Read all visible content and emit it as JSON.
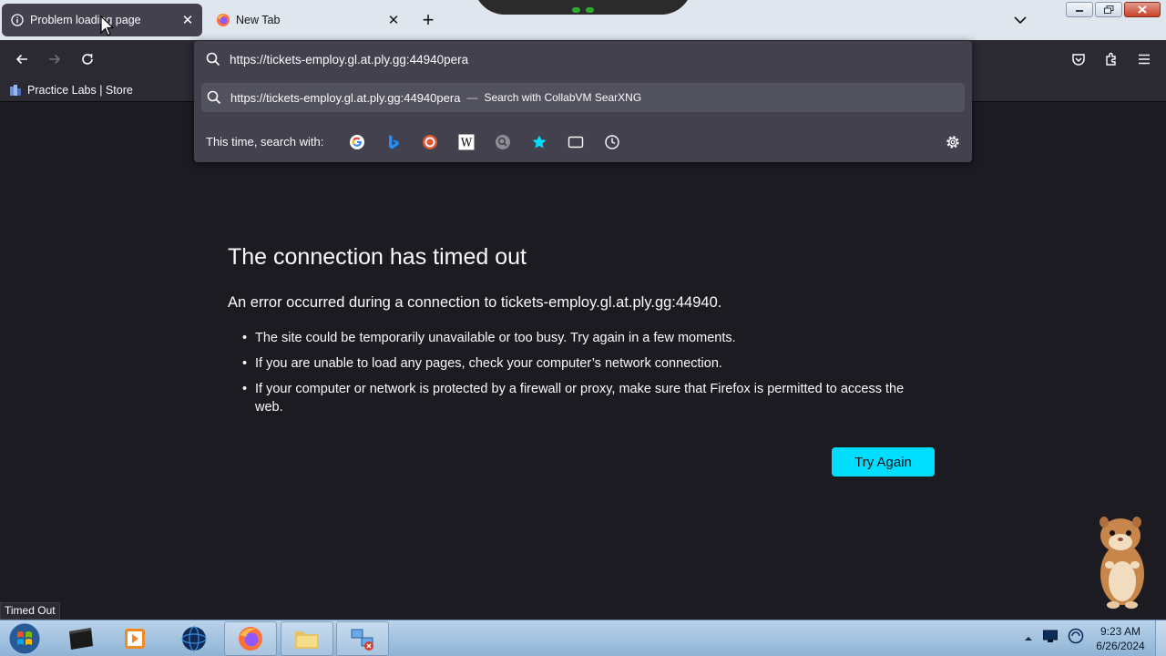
{
  "tabs": [
    {
      "title": "Problem loading page",
      "icon": "info-icon",
      "active": true
    },
    {
      "title": "New Tab",
      "icon": "firefox-icon",
      "active": false
    }
  ],
  "urlbar": {
    "value": "https://tickets-employ.gl.at.ply.gg:44940pera",
    "suggestion": {
      "text": "https://tickets-employ.gl.at.ply.gg:44940pera",
      "separator": "—",
      "action": "Search with CollabVM SearXNG"
    },
    "oneoff_label": "This time, search with:",
    "engines": [
      "google-icon",
      "bing-icon",
      "duckduckgo-icon",
      "wikipedia-icon",
      "searxng-icon",
      "bookmarks-icon",
      "tabs-icon",
      "history-icon"
    ]
  },
  "bookmarks": [
    {
      "label": "Practice Labs | Store"
    }
  ],
  "error": {
    "title": "The connection has timed out",
    "description": "An error occurred during a connection to tickets-employ.gl.at.ply.gg:44940.",
    "items": [
      "The site could be temporarily unavailable or too busy. Try again in a few moments.",
      "If you are unable to load any pages, check your computer’s network connection.",
      "If your computer or network is protected by a firewall or proxy, make sure that Firefox is permitted to access the web."
    ],
    "button": "Try Again"
  },
  "status": "Timed Out",
  "taskbar": {
    "time": "9:23 AM",
    "date": "6/26/2024"
  },
  "colors": {
    "accent": "#00ddff",
    "page_bg": "#1c1b22",
    "toolbar_bg": "#2b2a33",
    "panel_bg": "#42414d"
  }
}
